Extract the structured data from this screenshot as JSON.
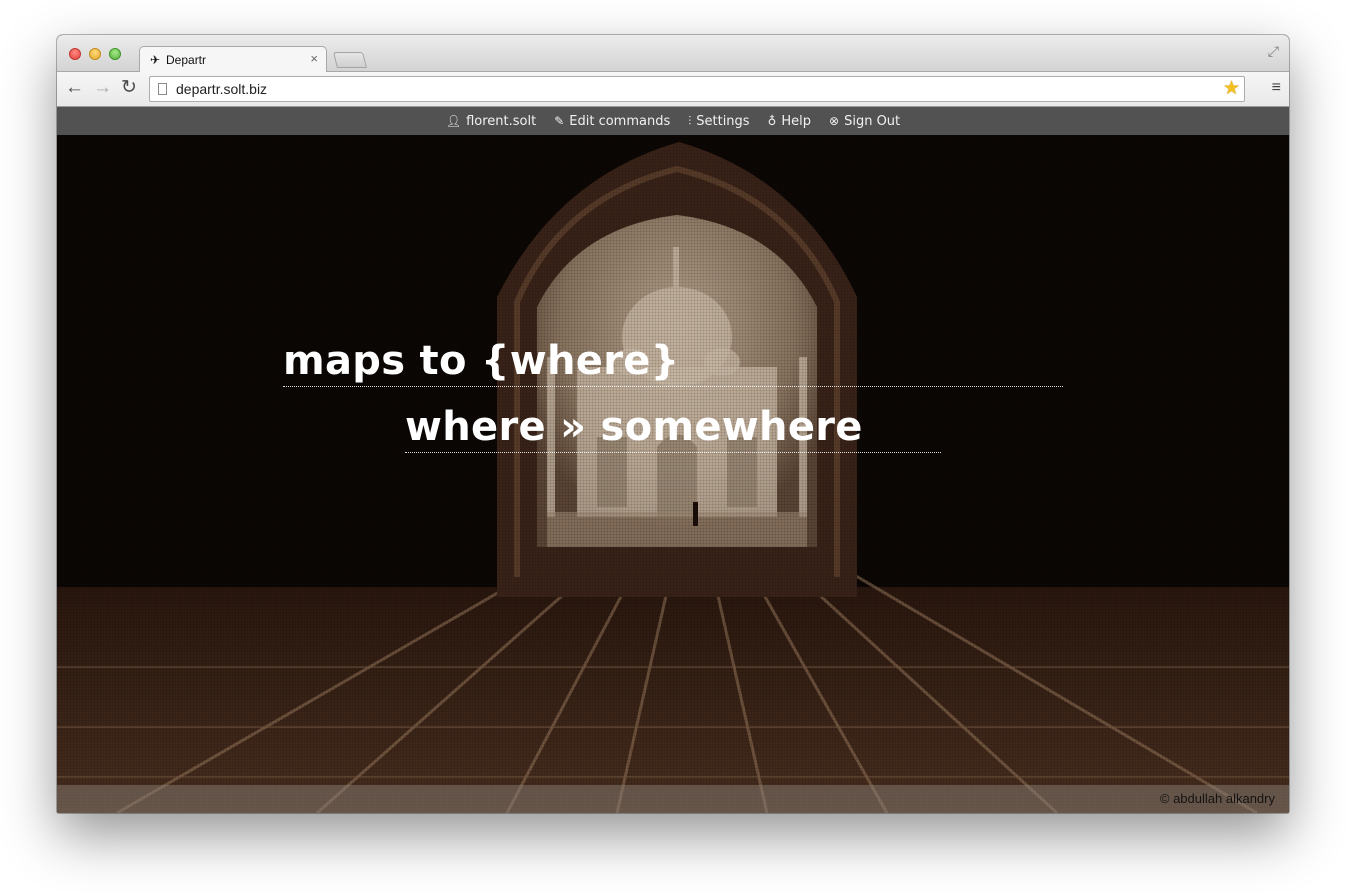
{
  "browser": {
    "tab": {
      "icon": "airplane-icon",
      "title": "Departr",
      "close_symbol": "×"
    },
    "url": "departr.solt.biz"
  },
  "userbar": {
    "items": [
      {
        "icon": "user-icon",
        "label": "florent.solt"
      },
      {
        "icon": "pencil-icon",
        "label": "Edit commands"
      },
      {
        "icon": "sliders-icon",
        "label": "Settings"
      },
      {
        "icon": "pin-icon",
        "label": "Help"
      },
      {
        "icon": "close-circle-icon",
        "label": "Sign Out"
      }
    ]
  },
  "commands": [
    {
      "text": "maps to {where}"
    },
    {
      "text": "where » somewhere"
    }
  ],
  "footer": {
    "credit": "© abdullah alkandry"
  },
  "colors": {
    "userbar_bg": "#606060",
    "text": "#ffffff",
    "accent_star": "#f4c020"
  }
}
